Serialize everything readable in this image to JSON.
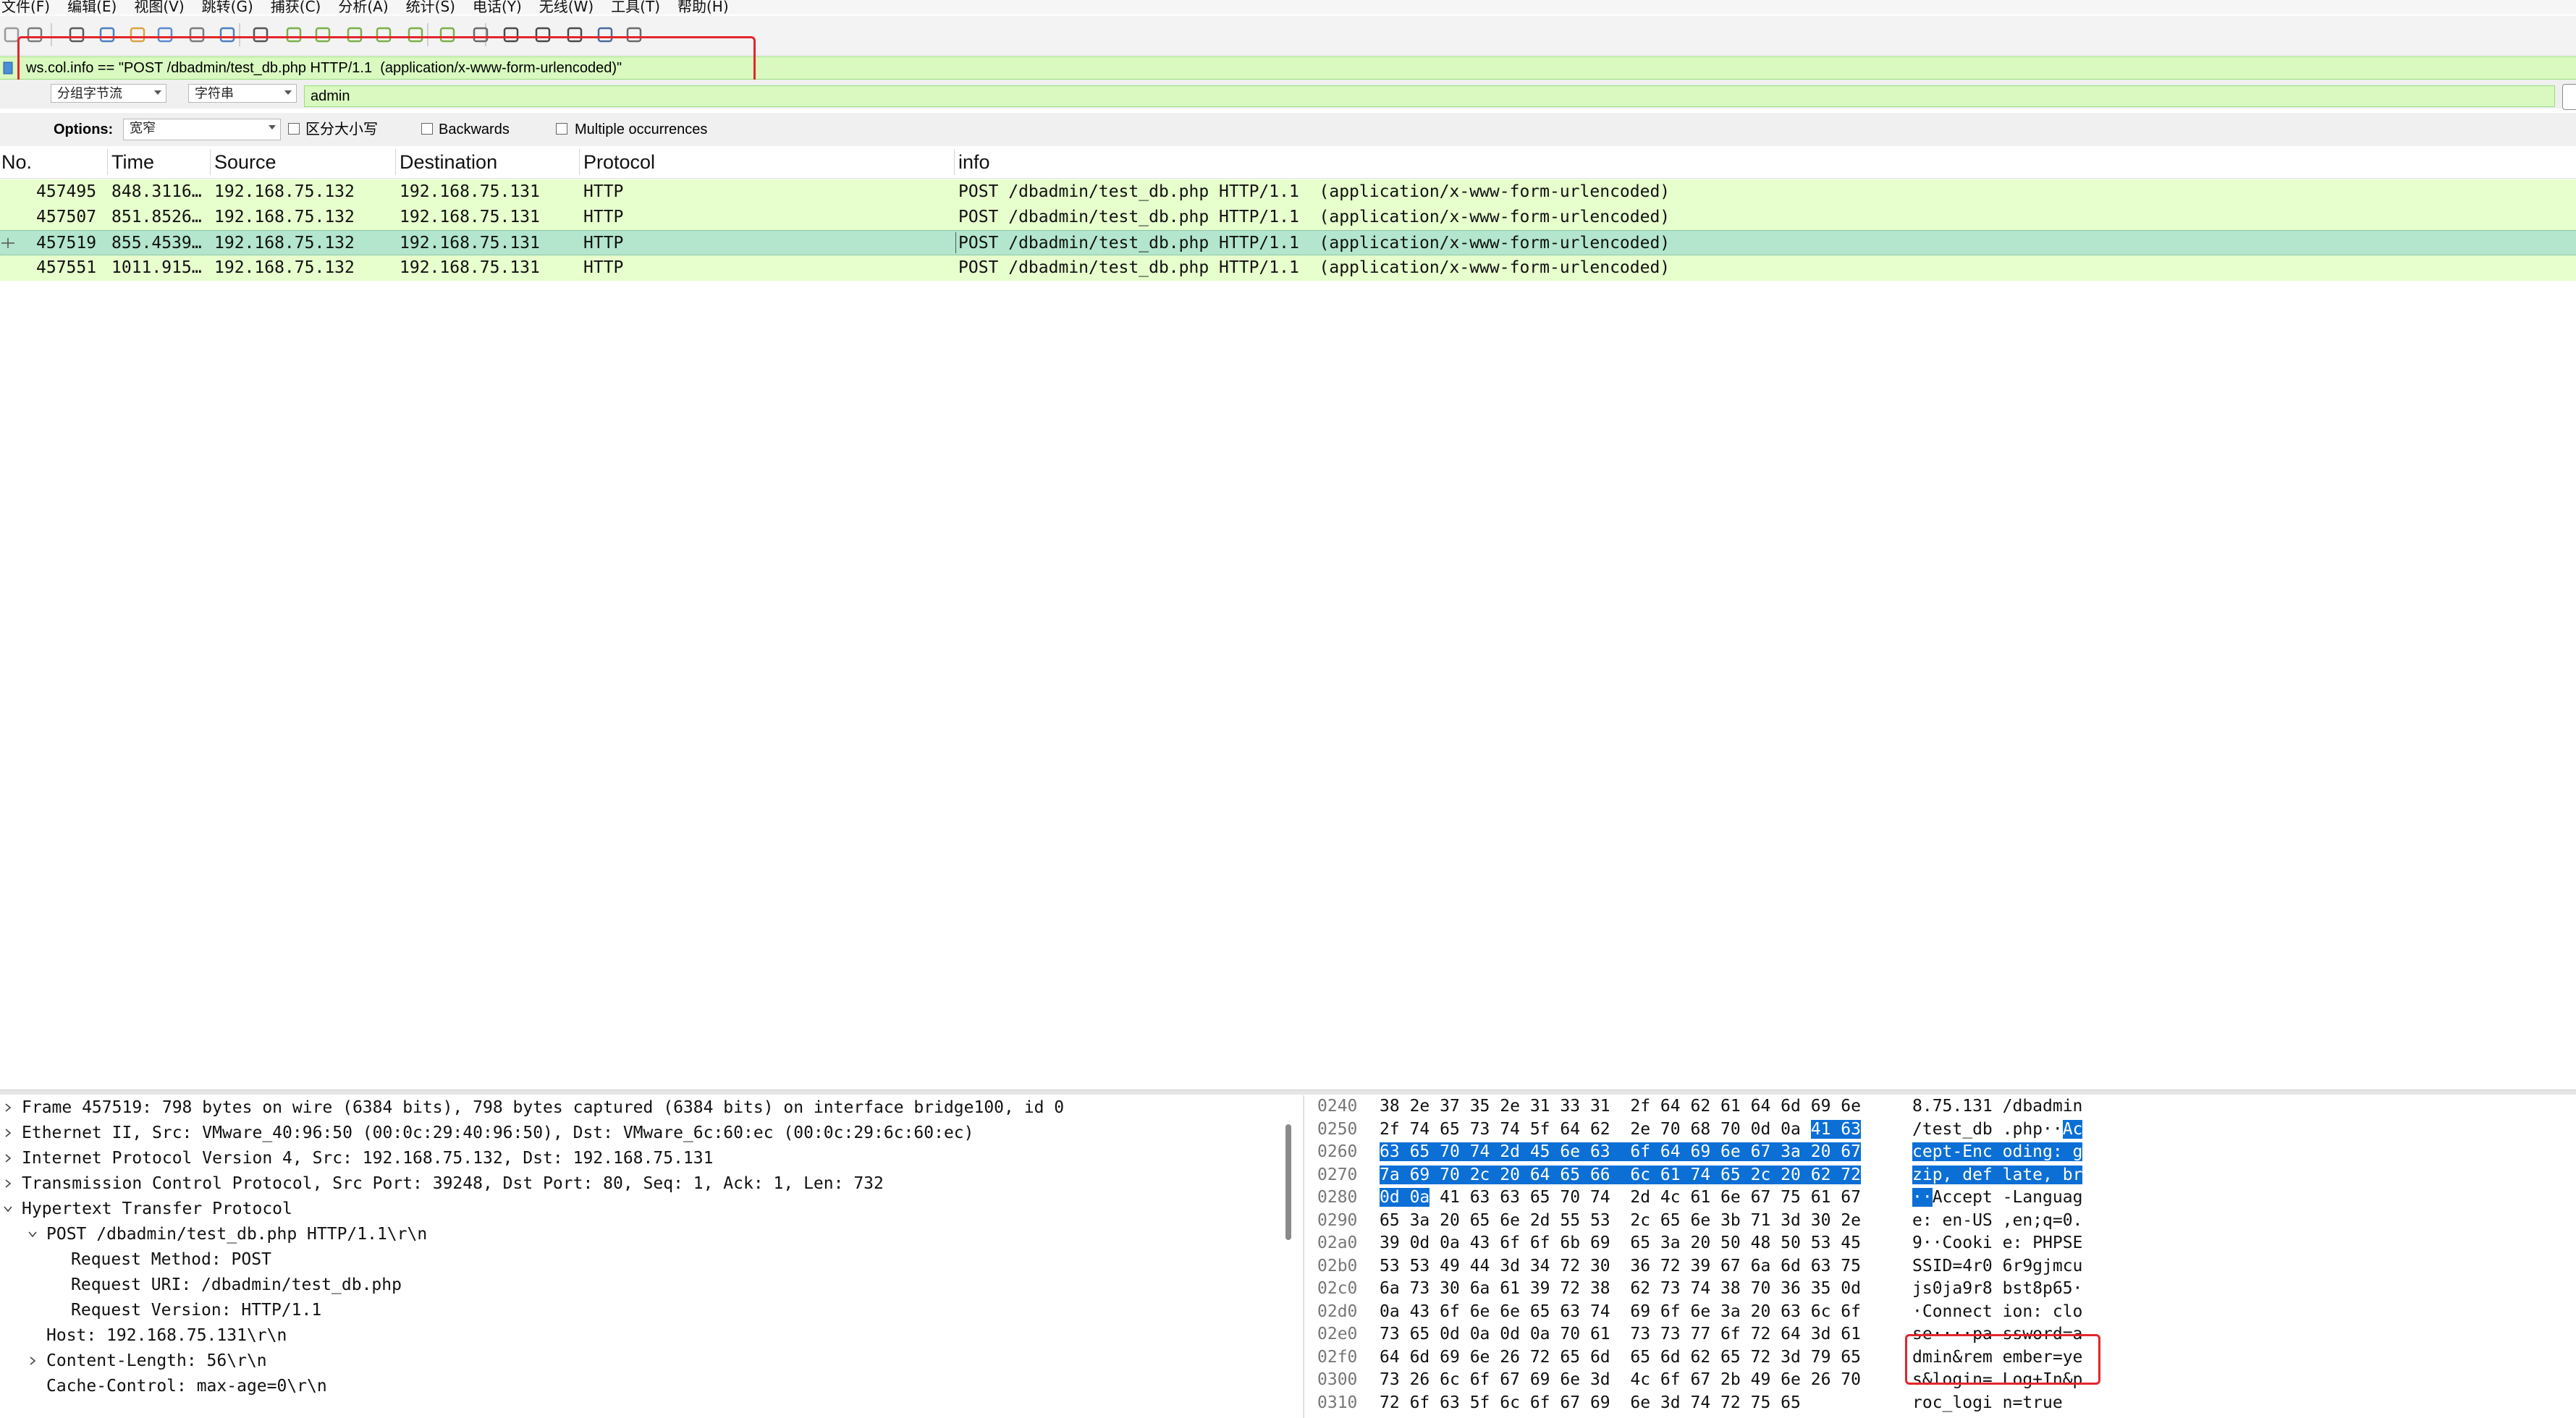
{
  "menubar": {
    "items": [
      "文件(F)",
      "编辑(E)",
      "视图(V)",
      "跳转(G)",
      "捕获(C)",
      "分析(A)",
      "统计(S)",
      "电话(Y)",
      "无线(W)",
      "工具(T)",
      "帮助(H)"
    ]
  },
  "filter": {
    "value": "ws.col.info == \"POST /dbadmin/test_db.php HTTP/1.1  (application/x-www-form-urlencoded)\""
  },
  "find": {
    "search_in": "分组字节流",
    "search_type": "字符串",
    "search_text": "admin"
  },
  "options": {
    "label": "Options:",
    "charset": "宽窄",
    "case_sensitive": "区分大小写",
    "backwards": "Backwards",
    "multiple": "Multiple occurrences"
  },
  "columns": {
    "no": "No.",
    "time": "Time",
    "source": "Source",
    "destination": "Destination",
    "protocol": "Protocol",
    "info": "info"
  },
  "packets": [
    {
      "no": "457495",
      "time": "848.3116…",
      "source": "192.168.75.132",
      "destination": "192.168.75.131",
      "protocol": "HTTP",
      "info": "POST /dbadmin/test_db.php HTTP/1.1  (application/x-www-form-urlencoded)",
      "selected": false
    },
    {
      "no": "457507",
      "time": "851.8526…",
      "source": "192.168.75.132",
      "destination": "192.168.75.131",
      "protocol": "HTTP",
      "info": "POST /dbadmin/test_db.php HTTP/1.1  (application/x-www-form-urlencoded)",
      "selected": false
    },
    {
      "no": "457519",
      "time": "855.4539…",
      "source": "192.168.75.132",
      "destination": "192.168.75.131",
      "protocol": "HTTP",
      "info": "POST /dbadmin/test_db.php HTTP/1.1  (application/x-www-form-urlencoded)",
      "selected": true
    },
    {
      "no": "457551",
      "time": "1011.915…",
      "source": "192.168.75.132",
      "destination": "192.168.75.131",
      "protocol": "HTTP",
      "info": "POST /dbadmin/test_db.php HTTP/1.1  (application/x-www-form-urlencoded)",
      "selected": false
    }
  ],
  "details": [
    {
      "indent": 0,
      "expander": "collapsed",
      "text": "Frame 457519: 798 bytes on wire (6384 bits), 798 bytes captured (6384 bits) on interface bridge100, id 0"
    },
    {
      "indent": 0,
      "expander": "collapsed",
      "text": "Ethernet II, Src: VMware_40:96:50 (00:0c:29:40:96:50), Dst: VMware_6c:60:ec (00:0c:29:6c:60:ec)"
    },
    {
      "indent": 0,
      "expander": "collapsed",
      "text": "Internet Protocol Version 4, Src: 192.168.75.132, Dst: 192.168.75.131"
    },
    {
      "indent": 0,
      "expander": "collapsed",
      "text": "Transmission Control Protocol, Src Port: 39248, Dst Port: 80, Seq: 1, Ack: 1, Len: 732"
    },
    {
      "indent": 0,
      "expander": "expanded",
      "text": "Hypertext Transfer Protocol"
    },
    {
      "indent": 1,
      "expander": "expanded",
      "text": "POST /dbadmin/test_db.php HTTP/1.1\\r\\n"
    },
    {
      "indent": 2,
      "expander": "none",
      "text": "Request Method: POST"
    },
    {
      "indent": 2,
      "expander": "none",
      "text": "Request URI: /dbadmin/test_db.php"
    },
    {
      "indent": 2,
      "expander": "none",
      "text": "Request Version: HTTP/1.1"
    },
    {
      "indent": 1,
      "expander": "none",
      "text": "Host: 192.168.75.131\\r\\n"
    },
    {
      "indent": 1,
      "expander": "collapsed",
      "text": "Content-Length: 56\\r\\n"
    },
    {
      "indent": 1,
      "expander": "none",
      "text": "Cache-Control: max-age=0\\r\\n"
    }
  ],
  "bytes": [
    {
      "offset": "0240",
      "hex": [
        "38",
        "2e",
        "37",
        "35",
        "2e",
        "31",
        "33",
        "31",
        "2f",
        "64",
        "62",
        "61",
        "64",
        "6d",
        "69",
        "6e"
      ],
      "ascii": "8.75.131 /dbadmin",
      "hl_from": -1,
      "hl_to": -1,
      "asc_hl_from": -1,
      "asc_hl_to": -1
    },
    {
      "offset": "0250",
      "hex": [
        "2f",
        "74",
        "65",
        "73",
        "74",
        "5f",
        "64",
        "62",
        "2e",
        "70",
        "68",
        "70",
        "0d",
        "0a",
        "41",
        "63"
      ],
      "ascii": "/test_db .php··Ac",
      "hl_from": 14,
      "hl_to": 15,
      "asc_hl_from": 15,
      "asc_hl_to": 17
    },
    {
      "offset": "0260",
      "hex": [
        "63",
        "65",
        "70",
        "74",
        "2d",
        "45",
        "6e",
        "63",
        "6f",
        "64",
        "69",
        "6e",
        "67",
        "3a",
        "20",
        "67"
      ],
      "ascii": "cept-Enc oding: g",
      "hl_from": 0,
      "hl_to": 15,
      "asc_hl_from": 0,
      "asc_hl_to": 17
    },
    {
      "offset": "0270",
      "hex": [
        "7a",
        "69",
        "70",
        "2c",
        "20",
        "64",
        "65",
        "66",
        "6c",
        "61",
        "74",
        "65",
        "2c",
        "20",
        "62",
        "72"
      ],
      "ascii": "zip, def late, br",
      "hl_from": 0,
      "hl_to": 15,
      "asc_hl_from": 0,
      "asc_hl_to": 17
    },
    {
      "offset": "0280",
      "hex": [
        "0d",
        "0a",
        "41",
        "63",
        "63",
        "65",
        "70",
        "74",
        "2d",
        "4c",
        "61",
        "6e",
        "67",
        "75",
        "61",
        "67"
      ],
      "ascii": "··Accept -Languag",
      "hl_from": 0,
      "hl_to": 1,
      "asc_hl_from": 0,
      "asc_hl_to": 2
    },
    {
      "offset": "0290",
      "hex": [
        "65",
        "3a",
        "20",
        "65",
        "6e",
        "2d",
        "55",
        "53",
        "2c",
        "65",
        "6e",
        "3b",
        "71",
        "3d",
        "30",
        "2e"
      ],
      "ascii": "e: en-US ,en;q=0.",
      "hl_from": -1,
      "hl_to": -1,
      "asc_hl_from": -1,
      "asc_hl_to": -1
    },
    {
      "offset": "02a0",
      "hex": [
        "39",
        "0d",
        "0a",
        "43",
        "6f",
        "6f",
        "6b",
        "69",
        "65",
        "3a",
        "20",
        "50",
        "48",
        "50",
        "53",
        "45"
      ],
      "ascii": "9··Cooki e: PHPSE",
      "hl_from": -1,
      "hl_to": -1,
      "asc_hl_from": -1,
      "asc_hl_to": -1
    },
    {
      "offset": "02b0",
      "hex": [
        "53",
        "53",
        "49",
        "44",
        "3d",
        "34",
        "72",
        "30",
        "36",
        "72",
        "39",
        "67",
        "6a",
        "6d",
        "63",
        "75"
      ],
      "ascii": "SSID=4r0 6r9gjmcu",
      "hl_from": -1,
      "hl_to": -1,
      "asc_hl_from": -1,
      "asc_hl_to": -1
    },
    {
      "offset": "02c0",
      "hex": [
        "6a",
        "73",
        "30",
        "6a",
        "61",
        "39",
        "72",
        "38",
        "62",
        "73",
        "74",
        "38",
        "70",
        "36",
        "35",
        "0d"
      ],
      "ascii": "js0ja9r8 bst8p65·",
      "hl_from": -1,
      "hl_to": -1,
      "asc_hl_from": -1,
      "asc_hl_to": -1
    },
    {
      "offset": "02d0",
      "hex": [
        "0a",
        "43",
        "6f",
        "6e",
        "6e",
        "65",
        "63",
        "74",
        "69",
        "6f",
        "6e",
        "3a",
        "20",
        "63",
        "6c",
        "6f"
      ],
      "ascii": "·Connect ion: clo",
      "hl_from": -1,
      "hl_to": -1,
      "asc_hl_from": -1,
      "asc_hl_to": -1
    },
    {
      "offset": "02e0",
      "hex": [
        "73",
        "65",
        "0d",
        "0a",
        "0d",
        "0a",
        "70",
        "61",
        "73",
        "73",
        "77",
        "6f",
        "72",
        "64",
        "3d",
        "61"
      ],
      "ascii": "se····pa ssword=a",
      "hl_from": -1,
      "hl_to": -1,
      "asc_hl_from": -1,
      "asc_hl_to": -1
    },
    {
      "offset": "02f0",
      "hex": [
        "64",
        "6d",
        "69",
        "6e",
        "26",
        "72",
        "65",
        "6d",
        "65",
        "6d",
        "62",
        "65",
        "72",
        "3d",
        "79",
        "65"
      ],
      "ascii": "dmin&rem ember=ye",
      "hl_from": -1,
      "hl_to": -1,
      "asc_hl_from": -1,
      "asc_hl_to": -1
    },
    {
      "offset": "0300",
      "hex": [
        "73",
        "26",
        "6c",
        "6f",
        "67",
        "69",
        "6e",
        "3d",
        "4c",
        "6f",
        "67",
        "2b",
        "49",
        "6e",
        "26",
        "70"
      ],
      "ascii": "s&login= Log+In&p",
      "hl_from": -1,
      "hl_to": -1,
      "asc_hl_from": -1,
      "asc_hl_to": -1
    },
    {
      "offset": "0310",
      "hex": [
        "72",
        "6f",
        "63",
        "5f",
        "6c",
        "6f",
        "67",
        "69",
        "6e",
        "3d",
        "74",
        "72",
        "75",
        "65"
      ],
      "ascii": "roc_logi n=true",
      "hl_from": -1,
      "hl_to": -1,
      "asc_hl_from": -1,
      "asc_hl_to": -1
    }
  ],
  "colors": {
    "filter_bg": "#d9f9c0",
    "row_bg": "#e6ffcc",
    "row_selected_bg": "#b3e6cc",
    "byte_highlight": "#0b6fd6",
    "annotation_red": "#e3262b"
  },
  "toolbar_icons": [
    "shark-fin-start-icon",
    "stop-icon",
    "restart-icon",
    "options-gear-icon",
    "open-folder-icon",
    "save-file-icon",
    "close-file-icon",
    "reload-icon",
    "find-packet-icon",
    "go-back-icon",
    "go-forward-icon",
    "go-to-packet-icon",
    "go-first-icon",
    "go-last-icon",
    "autoscroll-icon",
    "colorize-icon",
    "zoom-in-icon",
    "zoom-out-icon",
    "zoom-normal-icon",
    "resize-columns-icon",
    "expand-all-icon"
  ]
}
